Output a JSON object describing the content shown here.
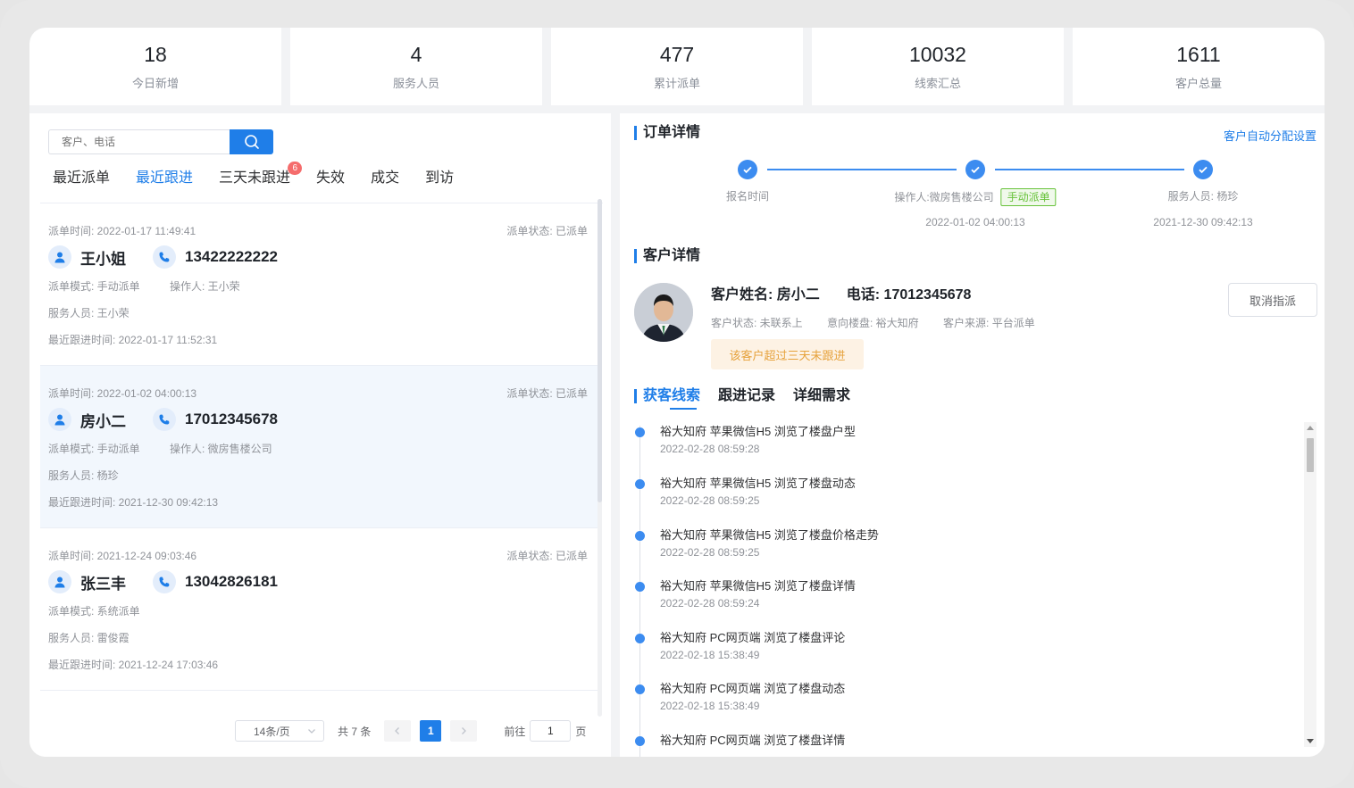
{
  "stats": [
    {
      "value": "18",
      "label": "今日新增"
    },
    {
      "value": "4",
      "label": "服务人员"
    },
    {
      "value": "477",
      "label": "累计派单"
    },
    {
      "value": "10032",
      "label": "线索汇总"
    },
    {
      "value": "1611",
      "label": "客户总量"
    }
  ],
  "search": {
    "placeholder": "客户、电话",
    "icon": "search-icon"
  },
  "tabs": [
    {
      "label": "最近派单"
    },
    {
      "label": "最近跟进",
      "active": true
    },
    {
      "label": "三天未跟进",
      "badge": "6"
    },
    {
      "label": "失效"
    },
    {
      "label": "成交"
    },
    {
      "label": "到访"
    }
  ],
  "orders": [
    {
      "time": "派单时间: 2022-01-17 11:49:41",
      "status": "派单状态: 已派单",
      "name": "王小姐",
      "phone": "13422222222",
      "mode": "派单模式: 手动派单",
      "operator": "操作人: 王小荣",
      "staff": "服务人员: 王小荣",
      "last_follow": "最近跟进时间: 2022-01-17 11:52:31"
    },
    {
      "time": "派单时间: 2022-01-02 04:00:13",
      "status": "派单状态: 已派单",
      "name": "房小二",
      "phone": "17012345678",
      "mode": "派单模式: 手动派单",
      "operator": "操作人: 微房售楼公司",
      "staff": "服务人员: 杨珍",
      "last_follow": "最近跟进时间: 2021-12-30 09:42:13"
    },
    {
      "time": "派单时间: 2021-12-24 09:03:46",
      "status": "派单状态: 已派单",
      "name": "张三丰",
      "phone": "13042826181",
      "mode": "派单模式: 系统派单",
      "operator": "",
      "staff": "服务人员: 雷俊霞",
      "last_follow": "最近跟进时间: 2021-12-24 17:03:46"
    }
  ],
  "pager": {
    "page_size": "14条/页",
    "total": "共 7 条",
    "current": "1",
    "goto_label": "前往",
    "goto_value": "1",
    "page_unit": "页"
  },
  "order_detail": {
    "title": "订单详情",
    "auto_setting": "客户自动分配设置",
    "steps": [
      {
        "label": "报名时间",
        "time": ""
      },
      {
        "label": "操作人:微房售楼公司",
        "tag": "手动派单",
        "time": "2022-01-02 04:00:13"
      },
      {
        "label": "服务人员: 杨珍",
        "time": "2021-12-30 09:42:13"
      }
    ]
  },
  "customer": {
    "title": "客户详情",
    "name": "客户姓名: 房小二",
    "phone": "电话: 17012345678",
    "status": "客户状态: 未联系上",
    "intent": "意向楼盘: 裕大知府",
    "source": "客户来源: 平台派单",
    "warning": "该客户超过三天未跟进",
    "cancel": "取消指派"
  },
  "sub_tabs": [
    {
      "label": "获客线索",
      "active": true
    },
    {
      "label": "跟进记录"
    },
    {
      "label": "详细需求"
    }
  ],
  "clues": [
    {
      "text": "裕大知府 苹果微信H5 浏览了楼盘户型",
      "time": "2022-02-28 08:59:28"
    },
    {
      "text": "裕大知府 苹果微信H5 浏览了楼盘动态",
      "time": "2022-02-28 08:59:25"
    },
    {
      "text": "裕大知府 苹果微信H5 浏览了楼盘价格走势",
      "time": "2022-02-28 08:59:25"
    },
    {
      "text": "裕大知府 苹果微信H5 浏览了楼盘详情",
      "time": "2022-02-28 08:59:24"
    },
    {
      "text": "裕大知府 PC网页端 浏览了楼盘评论",
      "time": "2022-02-18 15:38:49"
    },
    {
      "text": "裕大知府 PC网页端 浏览了楼盘动态",
      "time": "2022-02-18 15:38:49"
    },
    {
      "text": "裕大知府 PC网页端 浏览了楼盘详情",
      "time": ""
    }
  ],
  "colors": {
    "accent": "#1f7ee8",
    "badge": "#f56c6c",
    "tag_green": "#67c23a",
    "warn": "#e6a23c"
  }
}
